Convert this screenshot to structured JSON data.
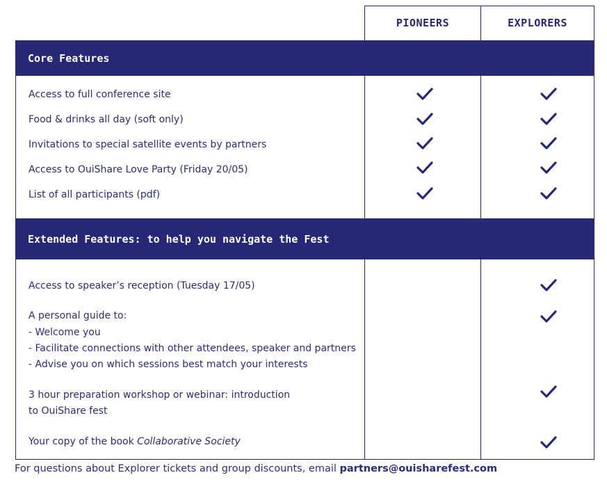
{
  "columns": {
    "pioneers": "PIONEERS",
    "explorers": "EXPLORERS"
  },
  "sections": {
    "core": {
      "title": "Core Features",
      "features": [
        "Access to full conference site",
        "Food & drinks all day (soft only)",
        "Invitations to special satellite events by partners",
        "Access to OuiShare Love Party (Friday 20/05)",
        "List of all participants (pdf)"
      ]
    },
    "extended": {
      "title": "Extended Features: to help you navigate the Fest",
      "features": {
        "reception": "Access to speaker’s reception (Tuesday 17/05)",
        "guide_title": "A personal guide to:",
        "guide_1": "- Welcome you",
        "guide_2": "- Facilitate connections with other attendees, speaker and partners",
        "guide_3": "- Advise you on which sessions best match your interests",
        "workshop_1": "3 hour preparation workshop or webinar: introduction",
        "workshop_2": "to OuiShare fest",
        "book_prefix": "Your copy of the book ",
        "book_title": "Collaborative Society"
      }
    }
  },
  "footer": {
    "text": "For questions about Explorer tickets and group discounts, email ",
    "email": "partners@ouisharefest.com"
  },
  "colors": {
    "navy": "#262876",
    "text": "#2b2d7a"
  },
  "icons": {
    "included": "check-icon"
  }
}
